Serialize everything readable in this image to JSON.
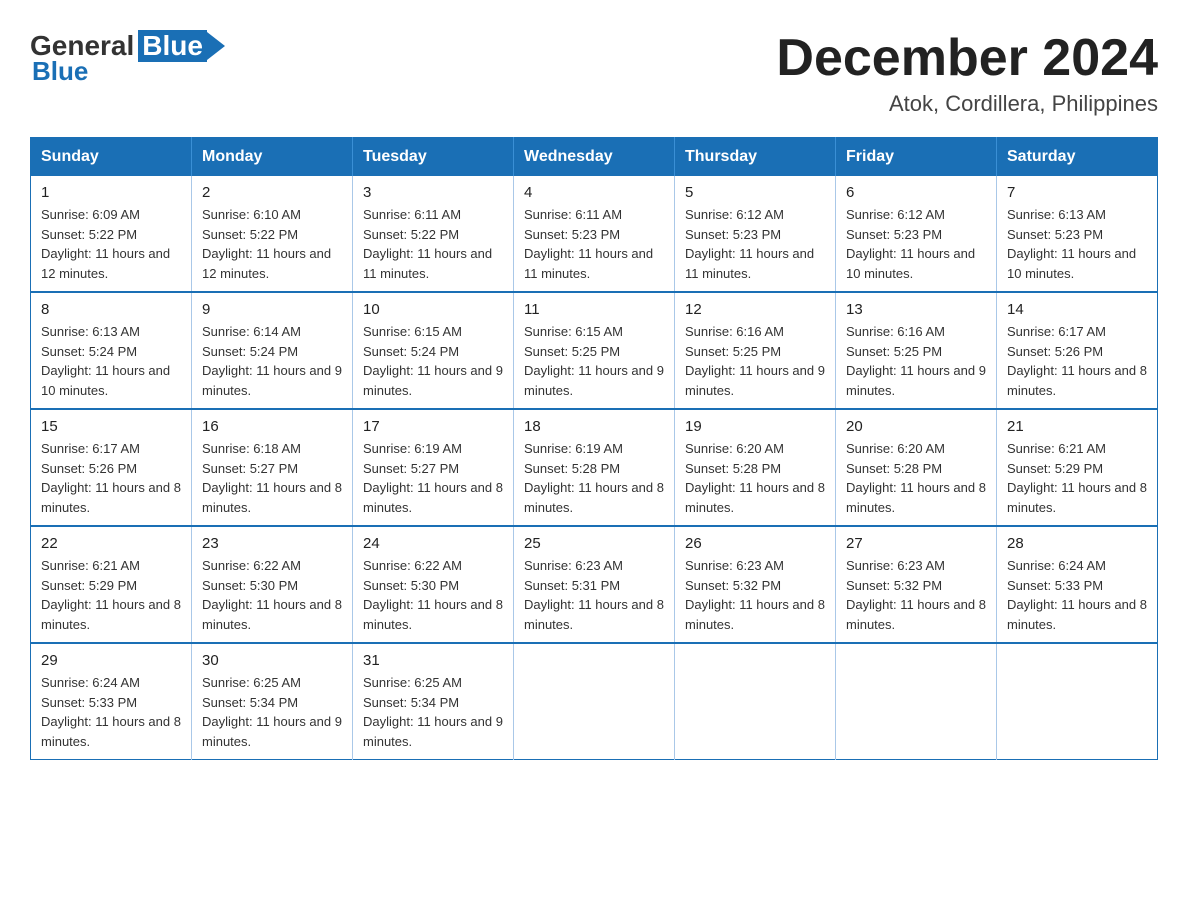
{
  "logo": {
    "general": "General",
    "blue": "Blue"
  },
  "title": "December 2024",
  "subtitle": "Atok, Cordillera, Philippines",
  "days_of_week": [
    "Sunday",
    "Monday",
    "Tuesday",
    "Wednesday",
    "Thursday",
    "Friday",
    "Saturday"
  ],
  "weeks": [
    [
      {
        "day": "1",
        "sunrise": "6:09 AM",
        "sunset": "5:22 PM",
        "daylight": "11 hours and 12 minutes."
      },
      {
        "day": "2",
        "sunrise": "6:10 AM",
        "sunset": "5:22 PM",
        "daylight": "11 hours and 12 minutes."
      },
      {
        "day": "3",
        "sunrise": "6:11 AM",
        "sunset": "5:22 PM",
        "daylight": "11 hours and 11 minutes."
      },
      {
        "day": "4",
        "sunrise": "6:11 AM",
        "sunset": "5:23 PM",
        "daylight": "11 hours and 11 minutes."
      },
      {
        "day": "5",
        "sunrise": "6:12 AM",
        "sunset": "5:23 PM",
        "daylight": "11 hours and 11 minutes."
      },
      {
        "day": "6",
        "sunrise": "6:12 AM",
        "sunset": "5:23 PM",
        "daylight": "11 hours and 10 minutes."
      },
      {
        "day": "7",
        "sunrise": "6:13 AM",
        "sunset": "5:23 PM",
        "daylight": "11 hours and 10 minutes."
      }
    ],
    [
      {
        "day": "8",
        "sunrise": "6:13 AM",
        "sunset": "5:24 PM",
        "daylight": "11 hours and 10 minutes."
      },
      {
        "day": "9",
        "sunrise": "6:14 AM",
        "sunset": "5:24 PM",
        "daylight": "11 hours and 9 minutes."
      },
      {
        "day": "10",
        "sunrise": "6:15 AM",
        "sunset": "5:24 PM",
        "daylight": "11 hours and 9 minutes."
      },
      {
        "day": "11",
        "sunrise": "6:15 AM",
        "sunset": "5:25 PM",
        "daylight": "11 hours and 9 minutes."
      },
      {
        "day": "12",
        "sunrise": "6:16 AM",
        "sunset": "5:25 PM",
        "daylight": "11 hours and 9 minutes."
      },
      {
        "day": "13",
        "sunrise": "6:16 AM",
        "sunset": "5:25 PM",
        "daylight": "11 hours and 9 minutes."
      },
      {
        "day": "14",
        "sunrise": "6:17 AM",
        "sunset": "5:26 PM",
        "daylight": "11 hours and 8 minutes."
      }
    ],
    [
      {
        "day": "15",
        "sunrise": "6:17 AM",
        "sunset": "5:26 PM",
        "daylight": "11 hours and 8 minutes."
      },
      {
        "day": "16",
        "sunrise": "6:18 AM",
        "sunset": "5:27 PM",
        "daylight": "11 hours and 8 minutes."
      },
      {
        "day": "17",
        "sunrise": "6:19 AM",
        "sunset": "5:27 PM",
        "daylight": "11 hours and 8 minutes."
      },
      {
        "day": "18",
        "sunrise": "6:19 AM",
        "sunset": "5:28 PM",
        "daylight": "11 hours and 8 minutes."
      },
      {
        "day": "19",
        "sunrise": "6:20 AM",
        "sunset": "5:28 PM",
        "daylight": "11 hours and 8 minutes."
      },
      {
        "day": "20",
        "sunrise": "6:20 AM",
        "sunset": "5:28 PM",
        "daylight": "11 hours and 8 minutes."
      },
      {
        "day": "21",
        "sunrise": "6:21 AM",
        "sunset": "5:29 PM",
        "daylight": "11 hours and 8 minutes."
      }
    ],
    [
      {
        "day": "22",
        "sunrise": "6:21 AM",
        "sunset": "5:29 PM",
        "daylight": "11 hours and 8 minutes."
      },
      {
        "day": "23",
        "sunrise": "6:22 AM",
        "sunset": "5:30 PM",
        "daylight": "11 hours and 8 minutes."
      },
      {
        "day": "24",
        "sunrise": "6:22 AM",
        "sunset": "5:30 PM",
        "daylight": "11 hours and 8 minutes."
      },
      {
        "day": "25",
        "sunrise": "6:23 AM",
        "sunset": "5:31 PM",
        "daylight": "11 hours and 8 minutes."
      },
      {
        "day": "26",
        "sunrise": "6:23 AM",
        "sunset": "5:32 PM",
        "daylight": "11 hours and 8 minutes."
      },
      {
        "day": "27",
        "sunrise": "6:23 AM",
        "sunset": "5:32 PM",
        "daylight": "11 hours and 8 minutes."
      },
      {
        "day": "28",
        "sunrise": "6:24 AM",
        "sunset": "5:33 PM",
        "daylight": "11 hours and 8 minutes."
      }
    ],
    [
      {
        "day": "29",
        "sunrise": "6:24 AM",
        "sunset": "5:33 PM",
        "daylight": "11 hours and 8 minutes."
      },
      {
        "day": "30",
        "sunrise": "6:25 AM",
        "sunset": "5:34 PM",
        "daylight": "11 hours and 9 minutes."
      },
      {
        "day": "31",
        "sunrise": "6:25 AM",
        "sunset": "5:34 PM",
        "daylight": "11 hours and 9 minutes."
      },
      null,
      null,
      null,
      null
    ]
  ],
  "labels": {
    "sunrise": "Sunrise: ",
    "sunset": "Sunset: ",
    "daylight": "Daylight: "
  }
}
